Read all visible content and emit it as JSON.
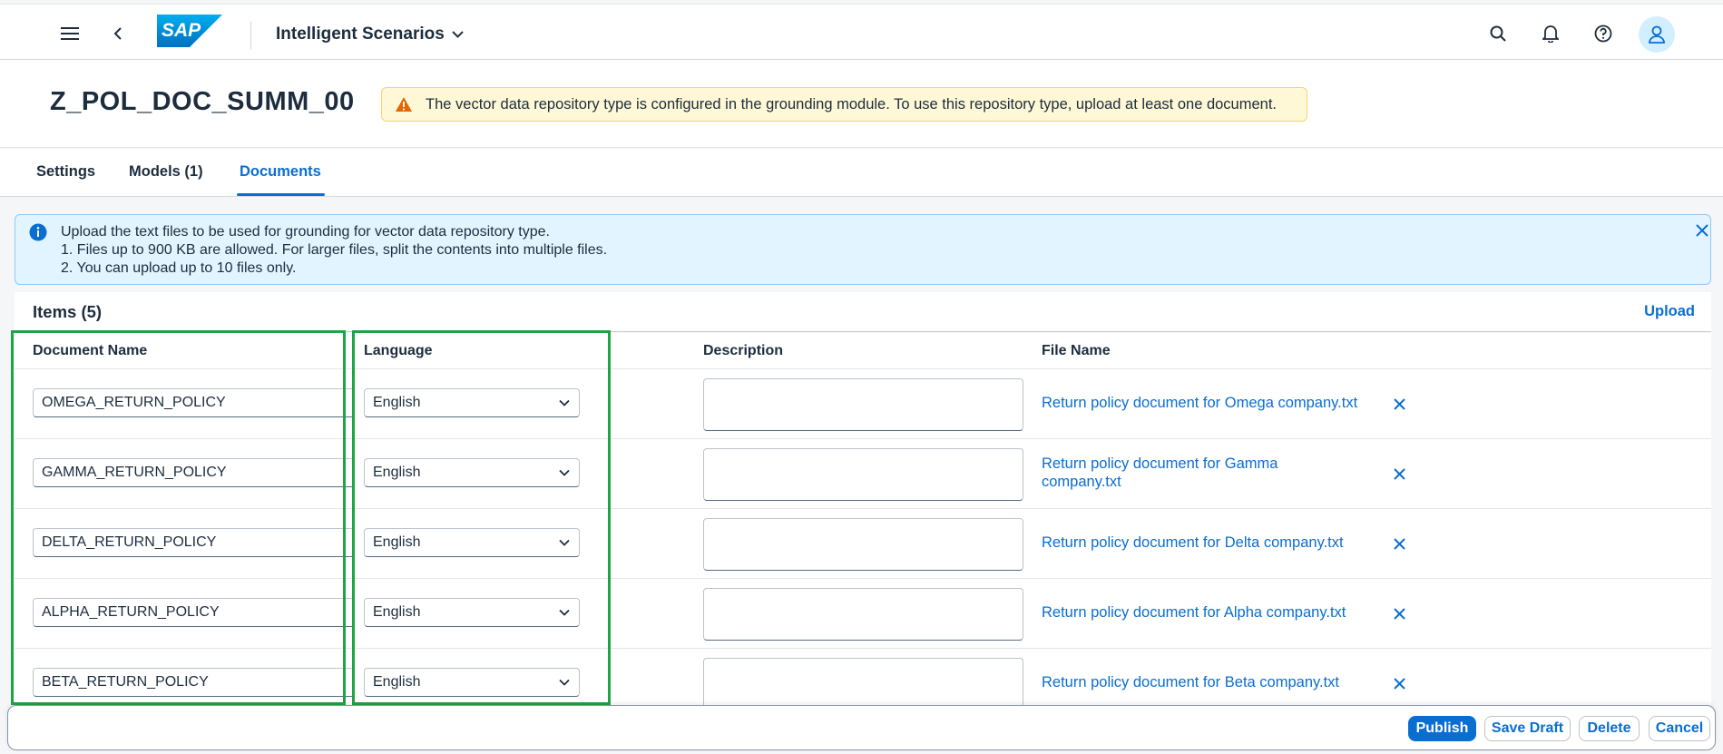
{
  "shell": {
    "app_title": "Intelligent Scenarios",
    "logo_text": "SAP"
  },
  "header": {
    "title": "Z_POL_DOC_SUMM_00",
    "warning": "The vector data repository type is configured in the grounding module. To use this repository type, upload at least one document."
  },
  "tabs": [
    {
      "label": "Settings"
    },
    {
      "label": "Models (1)"
    },
    {
      "label": "Documents"
    }
  ],
  "info": {
    "line1": "Upload the text files to be used for grounding for vector data repository type.",
    "line2": "1. Files up to 900 KB are allowed. For larger files, split the contents into multiple files.",
    "line3": "2. You can upload up to 10 files only."
  },
  "items": {
    "title": "Items (5)",
    "upload_label": "Upload",
    "columns": [
      "Document Name",
      "Language",
      "Description",
      "File Name"
    ],
    "rows": [
      {
        "name": "OMEGA_RETURN_POLICY",
        "language": "English",
        "description": "",
        "file_line1": "Return policy document for Omega company.txt",
        "file_line2": ""
      },
      {
        "name": "GAMMA_RETURN_POLICY",
        "language": "English",
        "description": "",
        "file_line1": "Return policy document for Gamma",
        "file_line2": "company.txt"
      },
      {
        "name": "DELTA_RETURN_POLICY",
        "language": "English",
        "description": "",
        "file_line1": "Return policy document for Delta company.txt",
        "file_line2": ""
      },
      {
        "name": "ALPHA_RETURN_POLICY",
        "language": "English",
        "description": "",
        "file_line1": "Return policy document for Alpha company.txt",
        "file_line2": ""
      },
      {
        "name": "BETA_RETURN_POLICY",
        "language": "English",
        "description": "",
        "file_line1": "Return policy document for Beta company.txt",
        "file_line2": ""
      }
    ]
  },
  "footer": {
    "publish": "Publish",
    "save_draft": "Save Draft",
    "delete": "Delete",
    "cancel": "Cancel"
  },
  "colors": {
    "accent": "#0a6ed1",
    "warning_bg": "#fff8d6",
    "info_bg": "#e1f4ff",
    "highlight": "#1fa445"
  },
  "icons": [
    "menu-icon",
    "back-icon",
    "chevron-down-icon",
    "search-icon",
    "bell-icon",
    "help-icon",
    "user-icon",
    "warning-icon",
    "info-icon",
    "close-icon"
  ]
}
